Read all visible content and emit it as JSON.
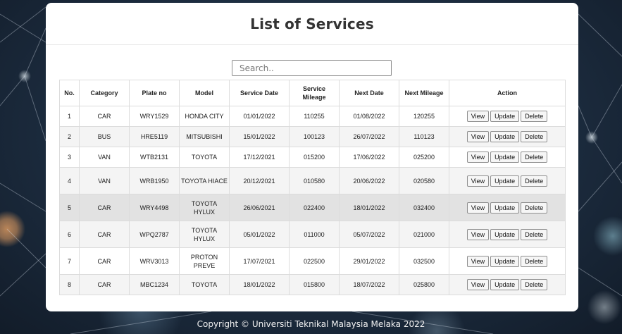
{
  "page": {
    "title": "List of Services",
    "footer": "Copyright © Universiti Teknikal Malaysia Melaka 2022"
  },
  "search": {
    "placeholder": "Search..",
    "value": ""
  },
  "table": {
    "headers": [
      "No.",
      "Category",
      "Plate no",
      "Model",
      "Service Date",
      "Service Mileage",
      "Next Date",
      "Next Mileage",
      "Action"
    ],
    "actions": {
      "view": "View",
      "update": "Update",
      "delete": "Delete"
    },
    "rows": [
      {
        "no": "1",
        "category": "CAR",
        "plate": "WRY1529",
        "model": "HONDA CITY",
        "service_date": "01/01/2022",
        "service_mileage": "110255",
        "next_date": "01/08/2022",
        "next_mileage": "120255"
      },
      {
        "no": "2",
        "category": "BUS",
        "plate": "HRE5119",
        "model": "MITSUBISHI",
        "service_date": "15/01/2022",
        "service_mileage": "100123",
        "next_date": "26/07/2022",
        "next_mileage": "110123"
      },
      {
        "no": "3",
        "category": "VAN",
        "plate": "WTB2131",
        "model": "TOYOTA",
        "service_date": "17/12/2021",
        "service_mileage": "015200",
        "next_date": "17/06/2022",
        "next_mileage": "025200"
      },
      {
        "no": "4",
        "category": "VAN",
        "plate": "WRB1950",
        "model": "TOYOTA HIACE",
        "service_date": "20/12/2021",
        "service_mileage": "010580",
        "next_date": "20/06/2022",
        "next_mileage": "020580"
      },
      {
        "no": "5",
        "category": "CAR",
        "plate": "WRY4498",
        "model": "TOYOTA HYLUX",
        "service_date": "26/06/2021",
        "service_mileage": "022400",
        "next_date": "18/01/2022",
        "next_mileage": "032400"
      },
      {
        "no": "6",
        "category": "CAR",
        "plate": "WPQ2787",
        "model": "TOYOTA HYLUX",
        "service_date": "05/01/2022",
        "service_mileage": "011000",
        "next_date": "05/07/2022",
        "next_mileage": "021000"
      },
      {
        "no": "7",
        "category": "CAR",
        "plate": "WRV3013",
        "model": "PROTON PREVE",
        "service_date": "17/07/2021",
        "service_mileage": "022500",
        "next_date": "29/01/2022",
        "next_mileage": "032500"
      },
      {
        "no": "8",
        "category": "CAR",
        "plate": "MBC1234",
        "model": "TOYOTA",
        "service_date": "18/01/2022",
        "service_mileage": "015800",
        "next_date": "18/07/2022",
        "next_mileage": "025800"
      }
    ]
  }
}
